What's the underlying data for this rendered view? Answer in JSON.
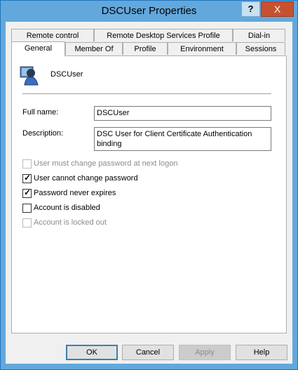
{
  "window": {
    "title": "DSCUser Properties",
    "help_symbol": "?",
    "close_symbol": "X"
  },
  "tabs_row1": [
    {
      "label": "Remote control"
    },
    {
      "label": "Remote Desktop Services Profile"
    },
    {
      "label": "Dial-in"
    }
  ],
  "tabs_row2": [
    {
      "label": "General"
    },
    {
      "label": "Member Of"
    },
    {
      "label": "Profile"
    },
    {
      "label": "Environment"
    },
    {
      "label": "Sessions"
    }
  ],
  "general": {
    "user_display": "DSCUser",
    "full_name_label": "Full name:",
    "full_name_value": "DSCUser",
    "description_label": "Description:",
    "description_value": "DSC User for Client Certificate Authentication binding"
  },
  "checkboxes": [
    {
      "label": "User must change password at next logon",
      "checked": false,
      "enabled": false
    },
    {
      "label": "User cannot change password",
      "checked": true,
      "enabled": true
    },
    {
      "label": "Password never expires",
      "checked": true,
      "enabled": true
    },
    {
      "label": "Account is disabled",
      "checked": false,
      "enabled": true
    },
    {
      "label": "Account is locked out",
      "checked": false,
      "enabled": false
    }
  ],
  "buttons": {
    "ok": "OK",
    "cancel": "Cancel",
    "apply": "Apply",
    "help": "Help"
  },
  "icons": {
    "user": "user-icon"
  },
  "colors": {
    "title_bar": "#62a8dd",
    "close_button": "#c7502f"
  }
}
